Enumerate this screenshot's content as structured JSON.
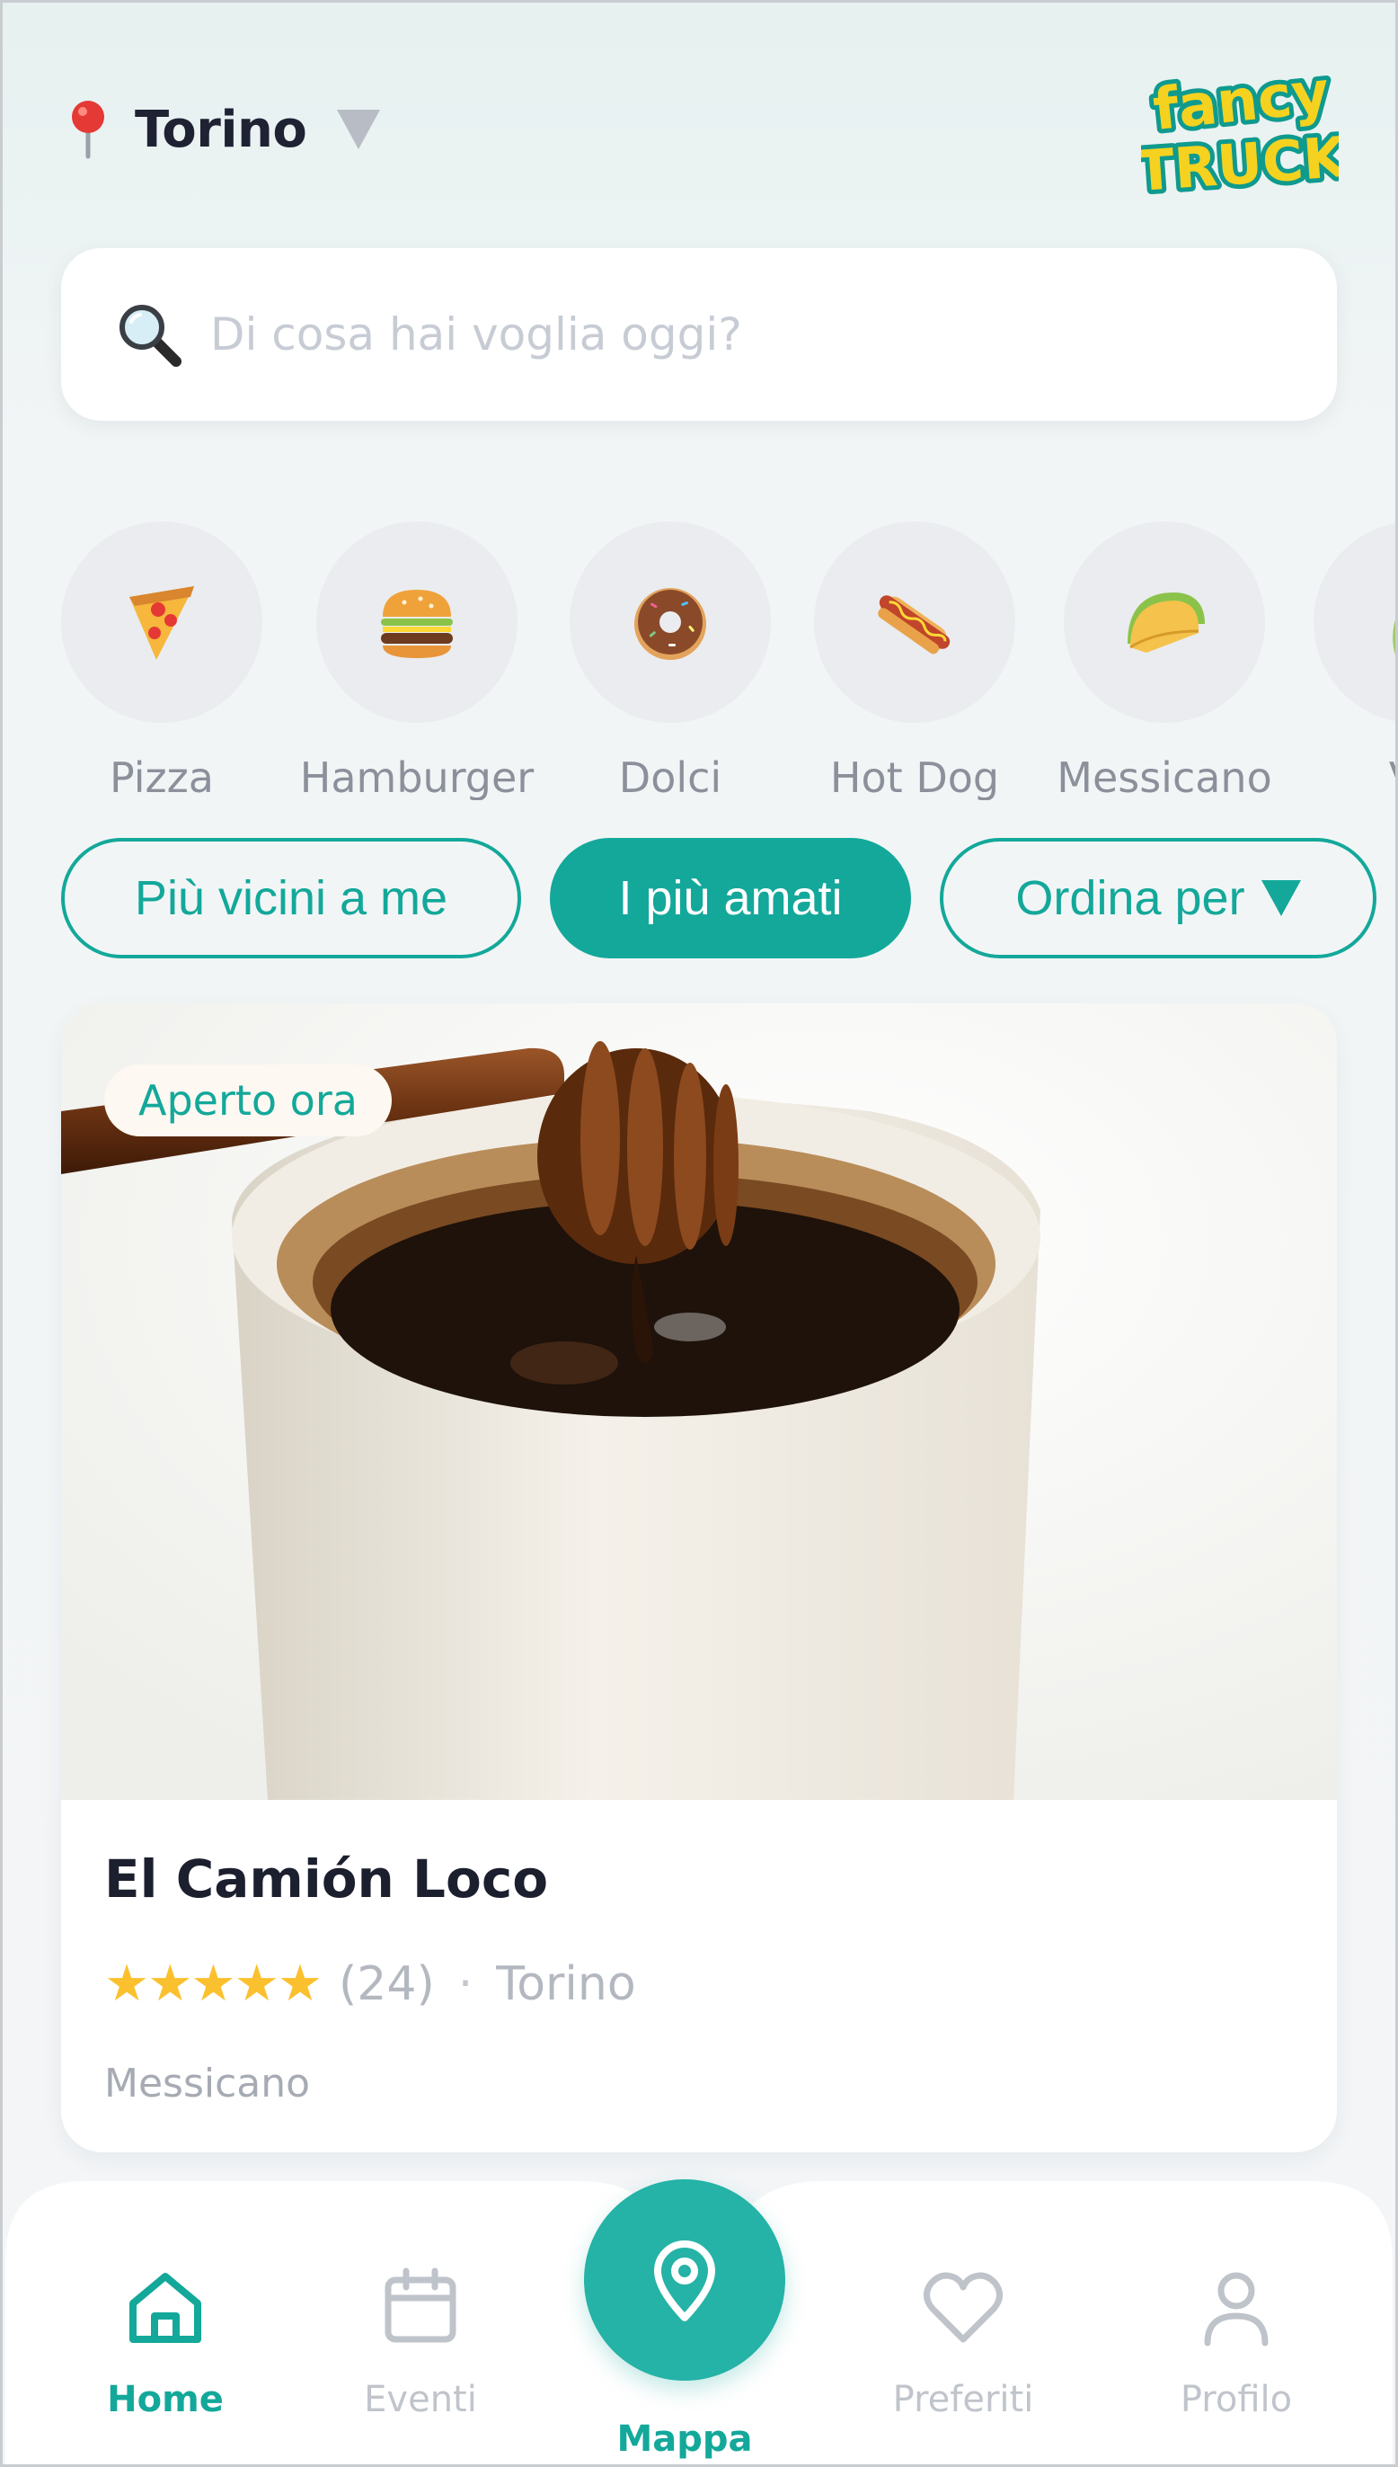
{
  "header": {
    "location": "Torino",
    "logo_text": [
      "fancy",
      "TRUCK"
    ]
  },
  "search": {
    "placeholder": "Di cosa hai voglia oggi?"
  },
  "categories": [
    {
      "label": "Pizza",
      "icon": "pizza-icon"
    },
    {
      "label": "Hamburger",
      "icon": "hamburger-icon"
    },
    {
      "label": "Dolci",
      "icon": "donut-icon"
    },
    {
      "label": "Hot Dog",
      "icon": "hotdog-icon"
    },
    {
      "label": "Messicano",
      "icon": "taco-icon"
    },
    {
      "label": "Ve",
      "icon": "vegetable-icon"
    }
  ],
  "filters": [
    {
      "label": "Più vicini a me",
      "active": false
    },
    {
      "label": "I più amati",
      "active": true
    },
    {
      "label": "Ordina per",
      "active": false
    }
  ],
  "card": {
    "badge": "Aperto ora",
    "title": "El Camión Loco",
    "stars": "★★★★★",
    "rating": 5,
    "count": "(24)",
    "separator": "·",
    "city": "Torino",
    "category": "Messicano"
  },
  "nav": {
    "home": "Home",
    "events": "Eventi",
    "map": "Mappa",
    "favorites": "Preferiti",
    "profile": "Profilo"
  },
  "colors": {
    "accent": "#13a89a",
    "star": "#fbc02d",
    "text_dark": "#1e2235",
    "text_muted": "#8b909a"
  }
}
